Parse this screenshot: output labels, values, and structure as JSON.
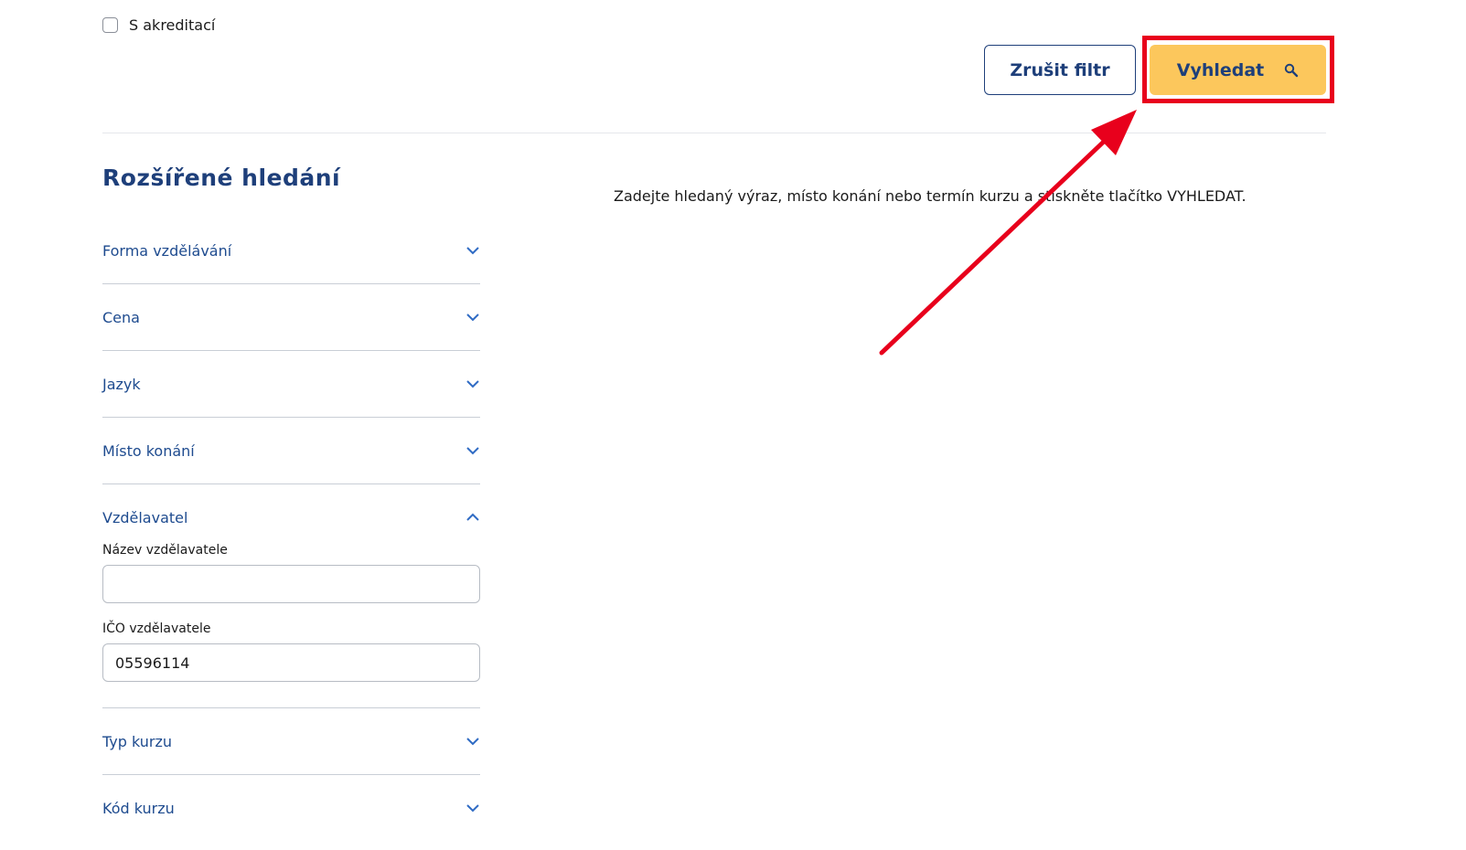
{
  "accreditation": {
    "label": "S akreditací",
    "checked": false
  },
  "actions": {
    "clear_label": "Zrušit filtr",
    "search_label": "Vyhledat",
    "search_icon": "search-icon"
  },
  "sidebar": {
    "title": "Rozšířené hledání"
  },
  "results": {
    "hint": "Zadejte hledaný výraz, místo konání nebo termín kurzu a stiskněte tlačítko VYHLEDAT."
  },
  "filters": [
    {
      "label": "Forma vzdělávání",
      "expanded": false
    },
    {
      "label": "Cena",
      "expanded": false
    },
    {
      "label": "Jazyk",
      "expanded": false
    },
    {
      "label": "Místo konání",
      "expanded": false
    },
    {
      "label": "Vzdělavatel",
      "expanded": true
    },
    {
      "label": "Typ kurzu",
      "expanded": false
    },
    {
      "label": "Kód kurzu",
      "expanded": false
    }
  ],
  "provider": {
    "name_label": "Název vzdělavatele",
    "name_value": "",
    "ico_label": "IČO vzdělavatele",
    "ico_value": "05596114"
  },
  "colors": {
    "brand_blue": "#1e3f7a",
    "link_blue": "#1e4b8f",
    "search_button": "#fcc75c",
    "annotation_red": "#e8001c"
  }
}
